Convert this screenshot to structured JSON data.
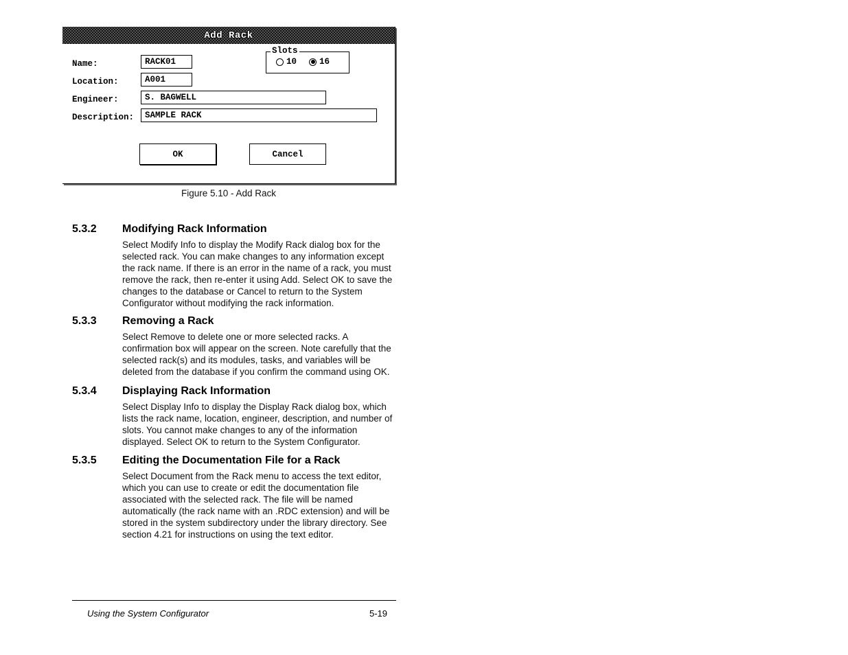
{
  "dialog": {
    "title": "Add Rack",
    "labels": {
      "name": "Name:",
      "location": "Location:",
      "engineer": "Engineer:",
      "description": "Description:"
    },
    "values": {
      "name": "RACK01",
      "location": "A001",
      "engineer": "S. BAGWELL",
      "description": "SAMPLE RACK"
    },
    "slots": {
      "legend": "Slots",
      "options": [
        "10",
        "16"
      ],
      "selected": "16"
    },
    "buttons": {
      "ok": "OK",
      "cancel": "Cancel"
    },
    "caption": "Figure 5.10 - Add Rack"
  },
  "sections": [
    {
      "num": "5.3.2",
      "head": "Modifying Rack Information",
      "body": "Select Modify Info to display the Modify Rack dialog box for the selected rack. You can make changes to any information except the rack name. If there is an error in the name of a rack, you must remove the rack, then re-enter it using Add. Select OK to save the changes to the database or Cancel to return to the System Configurator without modifying the rack information."
    },
    {
      "num": "5.3.3",
      "head": "Removing a Rack",
      "body": "Select Remove to delete one or more selected racks. A confirmation box will appear on the screen. Note carefully that the selected rack(s) and its modules, tasks, and variables will be deleted from the database if you confirm the command using OK."
    },
    {
      "num": "5.3.4",
      "head": "Displaying Rack Information",
      "body": "Select Display Info to display the Display Rack dialog box, which lists the rack name, location, engineer, description, and number of slots. You cannot make changes to any of the information displayed. Select OK to return to the System Configurator."
    },
    {
      "num": "5.3.5",
      "head": "Editing the Documentation File for a Rack",
      "body": "Select Document from the Rack menu to access the text editor, which you can use to create or edit the documentation file associated with the selected rack. The file will be named automatically (the rack name with an .RDC extension) and will be stored in the system subdirectory under the library directory. See section 4.21 for instructions on using the text editor."
    }
  ],
  "footer": {
    "left": "Using the System Configurator",
    "right": "5-19"
  }
}
